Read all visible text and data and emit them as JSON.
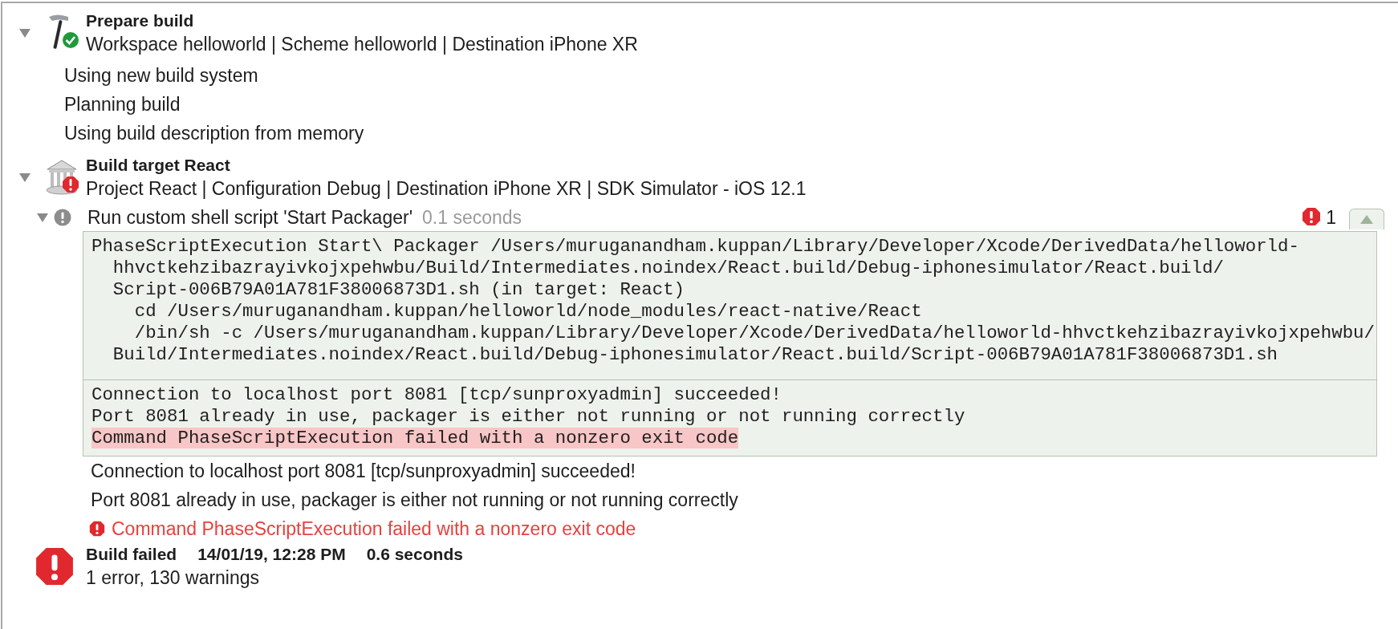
{
  "sections": [
    {
      "kind": "prepare",
      "failed": false,
      "expanded": true,
      "title": "Prepare build",
      "subtitle": "Workspace helloworld | Scheme helloworld | Destination iPhone XR",
      "children": [
        {
          "kind": "line",
          "text": "Using new build system"
        },
        {
          "kind": "line",
          "text": "Planning build"
        },
        {
          "kind": "line",
          "text": "Using build description from memory"
        }
      ]
    },
    {
      "kind": "target",
      "failed": true,
      "expanded": true,
      "title": "Build target React",
      "subtitle": "Project React | Configuration Debug | Destination iPhone XR | SDK Simulator - iOS 12.1",
      "children": [
        {
          "kind": "script",
          "expanded": true,
          "title": "Run custom shell script 'Start Packager'",
          "duration": "0.1 seconds",
          "error_count": "1",
          "command": [
            "PhaseScriptExecution Start\\ Packager /Users/muruganandham.kuppan/Library/Developer/Xcode/DerivedData/helloworld-",
            "  hhvctkehzibazrayivkojxpehwbu/Build/Intermediates.noindex/React.build/Debug-iphonesimulator/React.build/",
            "  Script-006B79A01A781F38006873D1.sh (in target: React)",
            "    cd /Users/muruganandham.kuppan/helloworld/node_modules/react-native/React",
            "    /bin/sh -c /Users/muruganandham.kuppan/Library/Developer/Xcode/DerivedData/helloworld-hhvctkehzibazrayivkojxpehwbu/",
            "  Build/Intermediates.noindex/React.build/Debug-iphonesimulator/React.build/Script-006B79A01A781F38006873D1.sh"
          ],
          "output": [
            {
              "text": "Connection to localhost port 8081 [tcp/sunproxyadmin] succeeded!",
              "highlighted": false
            },
            {
              "text": "Port 8081 already in use, packager is either not running or not running correctly",
              "highlighted": false
            },
            {
              "text": "Command PhaseScriptExecution failed with a nonzero exit code",
              "highlighted": true
            }
          ],
          "messages": [
            {
              "kind": "plain",
              "text": "Connection to localhost port 8081 [tcp/sunproxyadmin] succeeded!"
            },
            {
              "kind": "plain",
              "text": "Port 8081 already in use, packager is either not running or not running correctly"
            },
            {
              "kind": "error",
              "text": "Command PhaseScriptExecution failed with a nonzero exit code"
            }
          ]
        }
      ]
    }
  ],
  "summary": {
    "failed": true,
    "title": "Build failed",
    "date": "14/01/19, 12:28 PM",
    "duration": "0.6 seconds",
    "counts": "1 error, 130 warnings"
  }
}
